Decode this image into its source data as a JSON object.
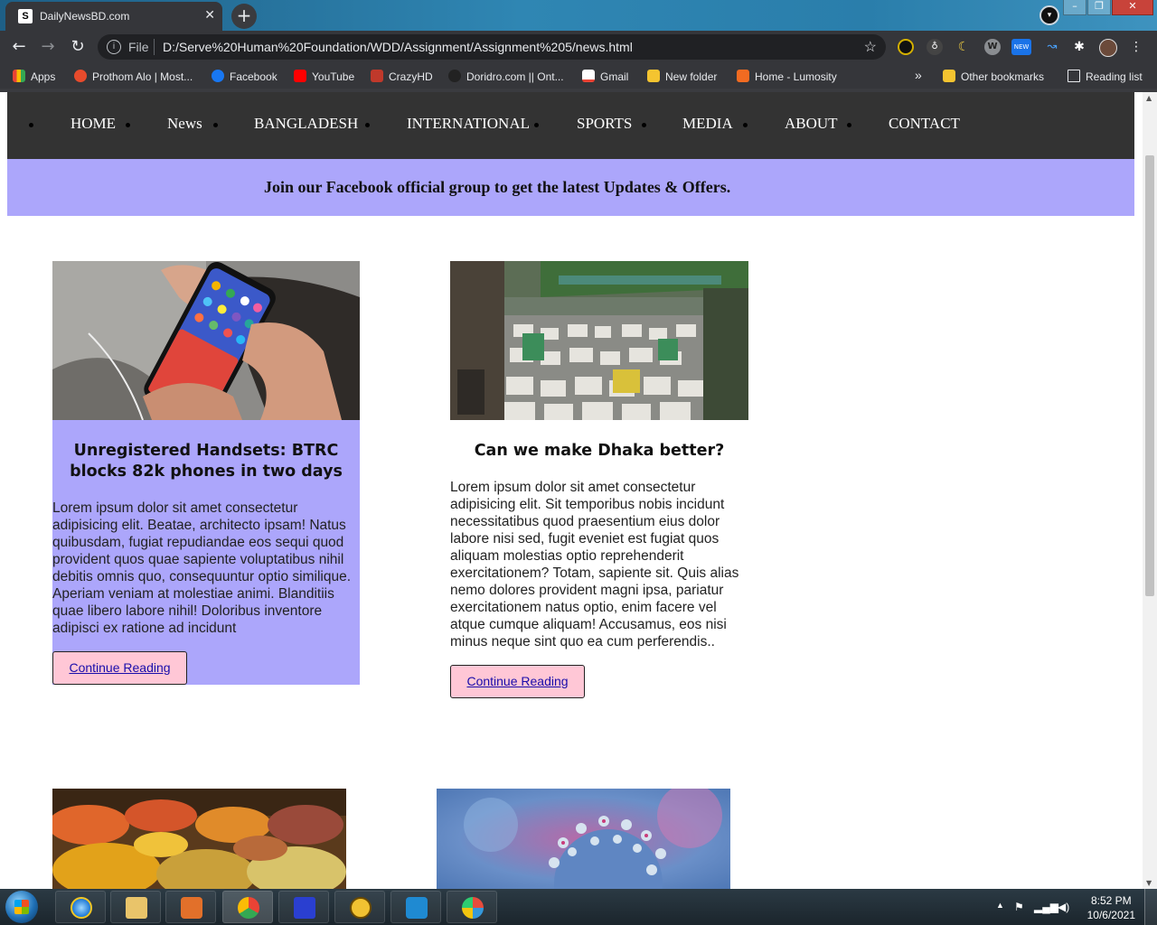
{
  "browser": {
    "tab_title": "DailyNewsBD.com",
    "tab_close": "✕",
    "new_tab": "+",
    "url_scheme": "File",
    "url": "D:/Serve%20Human%20Foundation/WDD/Assignment/Assignment%205/news.html",
    "bookmarks": [
      {
        "label": "Apps",
        "color": "#e8453c"
      },
      {
        "label": "Prothom Alo | Most...",
        "color": "#e84b2c"
      },
      {
        "label": "Facebook",
        "color": "#1877f2"
      },
      {
        "label": "YouTube",
        "color": "#ff0000"
      },
      {
        "label": "CrazyHD",
        "color": "#c0392b"
      },
      {
        "label": "Doridro.com || Ont...",
        "color": "#222222"
      },
      {
        "label": "Gmail",
        "color": "#ea4335"
      },
      {
        "label": "New folder",
        "color": "#f4c430"
      },
      {
        "label": "Home - Lumosity",
        "color": "#f26b21"
      }
    ],
    "bookmarks_overflow": "»",
    "other_bookmarks": "Other bookmarks",
    "reading_list": "Reading list",
    "ext_badge": "NEW"
  },
  "site": {
    "nav": [
      "HOME",
      "News",
      "BANGLADESH",
      "INTERNATIONAL",
      "SPORTS",
      "MEDIA",
      "ABOUT",
      "CONTACT"
    ],
    "banner": "Join our Facebook official group to get the latest Updates & Offers.",
    "accent_color": "#aca6fb",
    "button_color": "#ffc7d6",
    "articles": [
      {
        "title": "Unregistered Handsets: BTRC blocks 82k phones in two days",
        "body": "Lorem ipsum dolor sit amet consectetur adipisicing elit. Beatae, architecto ipsam! Natus quibusdam, fugiat repudiandae eos sequi quod provident quos quae sapiente voluptatibus nihil debitis omnis quo, consequuntur optio similique. Aperiam veniam at molestiae animi. Blanditiis quae libero labore nihil! Doloribus inventore adipisci ex ratione ad incidunt",
        "button": "Continue Reading"
      },
      {
        "title": "Can we make Dhaka better?",
        "body": "Lorem ipsum dolor sit amet consectetur adipisicing elit. Sit temporibus nobis incidunt necessitatibus quod praesentium eius dolor labore nisi sed, fugit eveniet est fugiat quos aliquam molestias optio reprehenderit exercitationem? Totam, sapiente sit. Quis alias nemo dolores provident magni ipsa, pariatur exercitationem natus optio, enim facere vel atque cumque aliquam! Accusamus, eos nisi minus neque sint quo ea cum perferendis..",
        "button": "Continue Reading"
      }
    ]
  },
  "taskbar": {
    "time": "8:52 PM",
    "date": "10/6/2021"
  }
}
